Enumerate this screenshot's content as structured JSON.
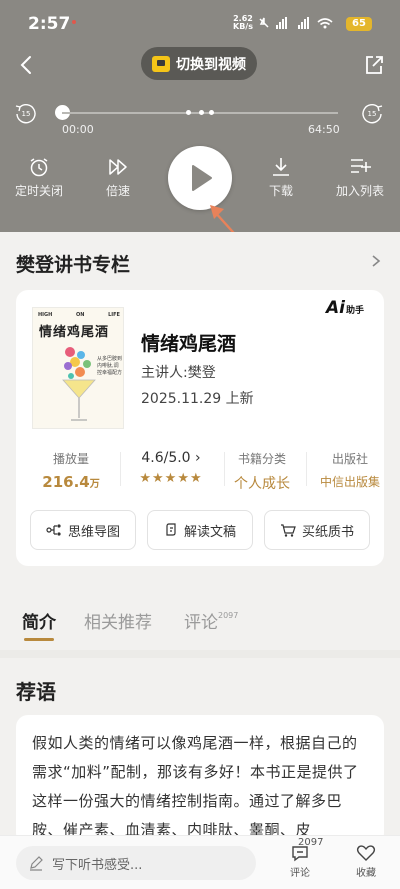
{
  "status_bar": {
    "time": "2:57",
    "net_speed_value": "2.62",
    "net_speed_unit": "KB/s",
    "signal_icons": "5G 5G",
    "battery": "65"
  },
  "player": {
    "switch_video_label": "切换到视频",
    "rewind_label": "15",
    "forward_label": "15",
    "time_current": "00:00",
    "time_total": "64:50",
    "progress": 0,
    "controls": {
      "timer": "定时关闭",
      "speed": "倍速",
      "download": "下载",
      "add_to_list": "加入列表"
    }
  },
  "column": {
    "title": "樊登讲书专栏"
  },
  "book": {
    "cover_top_left": "HIGH",
    "cover_top_mid": "ON",
    "cover_top_right": "LIFE",
    "cover_title": "情绪鸡尾酒",
    "cover_side": "从多巴胺到内啡肽,调控幸福配方",
    "ai_badge": "Ai",
    "ai_badge_suffix": "助手",
    "title": "情绪鸡尾酒",
    "speaker": "主讲人:樊登",
    "date": "2025.11.29 上新",
    "stats": {
      "plays_label": "播放量",
      "plays_value": "216.4",
      "plays_unit": "万",
      "rating_label": "4.6/5.0",
      "rating_value": 4.6,
      "stars": "★★★★★",
      "category_label": "书籍分类",
      "category_value": "个人成长",
      "publisher_label": "出版社",
      "publisher_value": "中信出版集"
    },
    "actions": {
      "mindmap": "思维导图",
      "interpret": "解读文稿",
      "buy": "买纸质书"
    }
  },
  "tabs": {
    "intro": "简介",
    "related": "相关推荐",
    "comments": "评论",
    "comments_count": "2097"
  },
  "recommendation": {
    "title": "荐语",
    "text": "假如人类的情绪可以像鸡尾酒一样，根据自己的需求“加料”配制，那该有多好！本书正是提供了这样一份强大的情绪控制指南。通过了解多巴胺、催产素、血清素、内啡肽、睾酮、皮"
  },
  "bottom_bar": {
    "comment_placeholder": "写下听书感受...",
    "comment_label": "评论",
    "comment_count": "2097",
    "favorite_label": "收藏"
  },
  "colors": {
    "header_bg": "#8a8883",
    "accent_gold": "#b8893d",
    "annotation_arrow": "#e8825a"
  }
}
